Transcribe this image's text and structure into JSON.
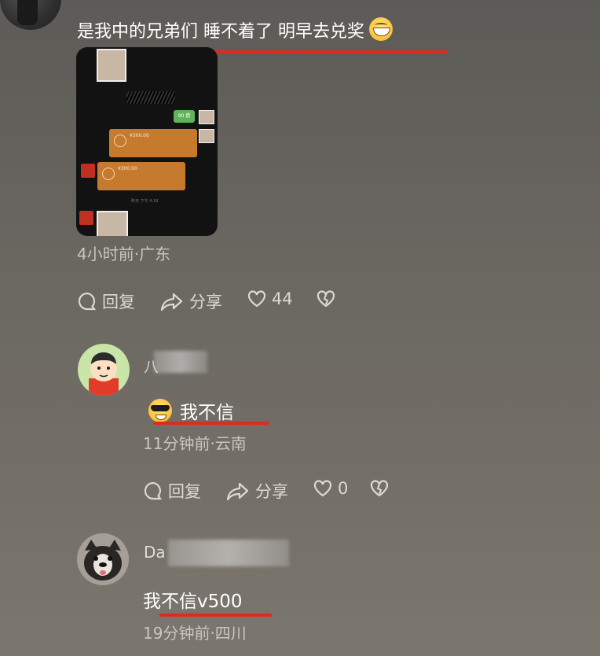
{
  "post": {
    "text": "是我中的兄弟们 睡不着了 明早去兑奖",
    "emoji": "grinning-face",
    "image": {
      "green_bubble": "90 借",
      "card1_amount": "¥300.00",
      "card2_amount": "¥300.00",
      "footer": "昨天 下午 4:18"
    },
    "meta": "4小时前·广东",
    "actions": {
      "reply": "回复",
      "share": "分享",
      "like_count": "44"
    }
  },
  "comments": [
    {
      "username_partial": "八",
      "emoji": "cool-sunglasses-face",
      "text": "我不信",
      "meta": "11分钟前·云南",
      "actions": {
        "reply": "回复",
        "share": "分享",
        "like_count": "0"
      }
    },
    {
      "username_partial": "Da",
      "text": "我不信v500",
      "meta": "19分钟前·四川"
    }
  ],
  "colors": {
    "annotation_red": "#e02a1d",
    "background": "#6a6761"
  },
  "icons": [
    "reply-bubble-icon",
    "share-arrow-icon",
    "heart-icon",
    "broken-heart-icon"
  ]
}
